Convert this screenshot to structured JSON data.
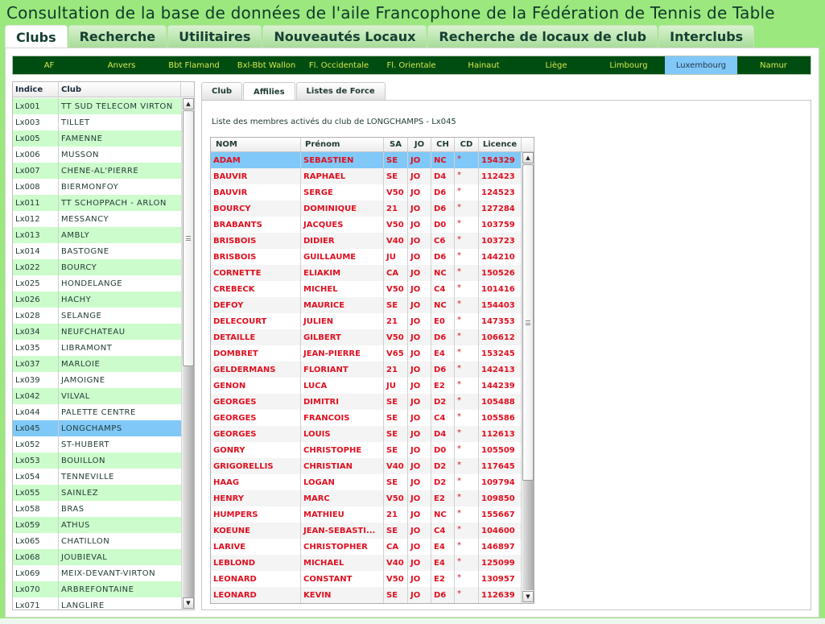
{
  "app": {
    "title": "Consultation de la base de données de l'aile Francophone de la Fédération de Tennis de Table"
  },
  "main_tabs": [
    {
      "label": "Clubs",
      "active": true
    },
    {
      "label": "Recherche",
      "active": false
    },
    {
      "label": "Utilitaires",
      "active": false
    },
    {
      "label": "Nouveautés Locaux",
      "active": false
    },
    {
      "label": "Recherche de locaux de club",
      "active": false
    },
    {
      "label": "Interclubs",
      "active": false
    }
  ],
  "regions": [
    {
      "label": "AF",
      "active": false
    },
    {
      "label": "Anvers",
      "active": false
    },
    {
      "label": "Bbt Flamand",
      "active": false
    },
    {
      "label": "Bxl-Bbt Wallon",
      "active": false
    },
    {
      "label": "Fl. Occidentale",
      "active": false
    },
    {
      "label": "Fl. Orientale",
      "active": false
    },
    {
      "label": "Hainaut",
      "active": false
    },
    {
      "label": "Liège",
      "active": false
    },
    {
      "label": "Limbourg",
      "active": false
    },
    {
      "label": "Luxembourg",
      "active": true
    },
    {
      "label": "Namur",
      "active": false
    }
  ],
  "club_list": {
    "headers": {
      "indice": "Indice",
      "club": "Club"
    },
    "selected_index": "Lx045",
    "rows": [
      {
        "indice": "Lx001",
        "club": "TT SUD TELECOM VIRTON"
      },
      {
        "indice": "Lx003",
        "club": "TILLET"
      },
      {
        "indice": "Lx005",
        "club": "FAMENNE"
      },
      {
        "indice": "Lx006",
        "club": "MUSSON"
      },
      {
        "indice": "Lx007",
        "club": "CHENE-AL'PIERRE"
      },
      {
        "indice": "Lx008",
        "club": "BIERMONFOY"
      },
      {
        "indice": "Lx011",
        "club": "TT SCHOPPACH - ARLON"
      },
      {
        "indice": "Lx012",
        "club": "MESSANCY"
      },
      {
        "indice": "Lx013",
        "club": "AMBLY"
      },
      {
        "indice": "Lx014",
        "club": "BASTOGNE"
      },
      {
        "indice": "Lx022",
        "club": "BOURCY"
      },
      {
        "indice": "Lx025",
        "club": "HONDELANGE"
      },
      {
        "indice": "Lx026",
        "club": "HACHY"
      },
      {
        "indice": "Lx028",
        "club": "SELANGE"
      },
      {
        "indice": "Lx034",
        "club": "NEUFCHATEAU"
      },
      {
        "indice": "Lx035",
        "club": "LIBRAMONT"
      },
      {
        "indice": "Lx037",
        "club": "MARLOIE"
      },
      {
        "indice": "Lx039",
        "club": "JAMOIGNE"
      },
      {
        "indice": "Lx042",
        "club": "VILVAL"
      },
      {
        "indice": "Lx044",
        "club": "PALETTE CENTRE"
      },
      {
        "indice": "Lx045",
        "club": "LONGCHAMPS"
      },
      {
        "indice": "Lx052",
        "club": "ST-HUBERT"
      },
      {
        "indice": "Lx053",
        "club": "BOUILLON"
      },
      {
        "indice": "Lx054",
        "club": "TENNEVILLE"
      },
      {
        "indice": "Lx055",
        "club": "SAINLEZ"
      },
      {
        "indice": "Lx058",
        "club": "BRAS"
      },
      {
        "indice": "Lx059",
        "club": "ATHUS"
      },
      {
        "indice": "Lx065",
        "club": "CHATILLON"
      },
      {
        "indice": "Lx068",
        "club": "JOUBIEVAL"
      },
      {
        "indice": "Lx069",
        "club": "MEIX-DEVANT-VIRTON"
      },
      {
        "indice": "Lx070",
        "club": "ARBREFONTAINE"
      },
      {
        "indice": "Lx071",
        "club": "LANGLIRE"
      }
    ]
  },
  "sub_tabs": [
    {
      "label": "Club",
      "active": false
    },
    {
      "label": "Affilies",
      "active": true
    },
    {
      "label": "Listes de Force",
      "active": false
    }
  ],
  "members": {
    "caption": "Liste des membres activés du club de LONGCHAMPS - Lx045",
    "headers": {
      "nom": "NOM",
      "prenom": "Prénom",
      "sa": "SA",
      "jo": "JO",
      "ch": "CH",
      "cd": "CD",
      "licence": "Licence"
    },
    "selected_licence": "154329",
    "rows": [
      {
        "nom": "ADAM",
        "prenom": "SEBASTIEN",
        "sa": "SE",
        "jo": "JO",
        "ch": "NC",
        "cd": "*",
        "licence": "154329"
      },
      {
        "nom": "BAUVIR",
        "prenom": "RAPHAEL",
        "sa": "SE",
        "jo": "JO",
        "ch": "D4",
        "cd": "*",
        "licence": "112423"
      },
      {
        "nom": "BAUVIR",
        "prenom": "SERGE",
        "sa": "V50",
        "jo": "JO",
        "ch": "D6",
        "cd": "*",
        "licence": "124523"
      },
      {
        "nom": "BOURCY",
        "prenom": "DOMINIQUE",
        "sa": "21",
        "jo": "JO",
        "ch": "D6",
        "cd": "*",
        "licence": "127284"
      },
      {
        "nom": "BRABANTS",
        "prenom": "JACQUES",
        "sa": "V50",
        "jo": "JO",
        "ch": "D0",
        "cd": "*",
        "licence": "103759"
      },
      {
        "nom": "BRISBOIS",
        "prenom": "DIDIER",
        "sa": "V40",
        "jo": "JO",
        "ch": "C6",
        "cd": "*",
        "licence": "103723"
      },
      {
        "nom": "BRISBOIS",
        "prenom": "GUILLAUME",
        "sa": "JU",
        "jo": "JO",
        "ch": "D6",
        "cd": "*",
        "licence": "144210"
      },
      {
        "nom": "CORNETTE",
        "prenom": "ELIAKIM",
        "sa": "CA",
        "jo": "JO",
        "ch": "NC",
        "cd": "*",
        "licence": "150526"
      },
      {
        "nom": "CREBECK",
        "prenom": "MICHEL",
        "sa": "V50",
        "jo": "JO",
        "ch": "C4",
        "cd": "*",
        "licence": "101416"
      },
      {
        "nom": "DEFOY",
        "prenom": "MAURICE",
        "sa": "SE",
        "jo": "JO",
        "ch": "NC",
        "cd": "*",
        "licence": "154403"
      },
      {
        "nom": "DELECOURT",
        "prenom": "JULIEN",
        "sa": "21",
        "jo": "JO",
        "ch": "E0",
        "cd": "*",
        "licence": "147353"
      },
      {
        "nom": "DETAILLE",
        "prenom": "GILBERT",
        "sa": "V50",
        "jo": "JO",
        "ch": "D6",
        "cd": "*",
        "licence": "106612"
      },
      {
        "nom": "DOMBRET",
        "prenom": "JEAN-PIERRE",
        "sa": "V65",
        "jo": "JO",
        "ch": "E4",
        "cd": "*",
        "licence": "153245"
      },
      {
        "nom": "GELDERMANS",
        "prenom": "FLORIANT",
        "sa": "21",
        "jo": "JO",
        "ch": "D6",
        "cd": "*",
        "licence": "142413"
      },
      {
        "nom": "GENON",
        "prenom": "LUCA",
        "sa": "JU",
        "jo": "JO",
        "ch": "E2",
        "cd": "*",
        "licence": "144239"
      },
      {
        "nom": "GEORGES",
        "prenom": "DIMITRI",
        "sa": "SE",
        "jo": "JO",
        "ch": "D2",
        "cd": "*",
        "licence": "105488"
      },
      {
        "nom": "GEORGES",
        "prenom": "FRANCOIS",
        "sa": "SE",
        "jo": "JO",
        "ch": "C4",
        "cd": "*",
        "licence": "105586"
      },
      {
        "nom": "GEORGES",
        "prenom": "LOUIS",
        "sa": "SE",
        "jo": "JO",
        "ch": "D4",
        "cd": "*",
        "licence": "112613"
      },
      {
        "nom": "GONRY",
        "prenom": "CHRISTOPHE",
        "sa": "SE",
        "jo": "JO",
        "ch": "D0",
        "cd": "*",
        "licence": "105509"
      },
      {
        "nom": "GRIGORELLIS",
        "prenom": "CHRISTIAN",
        "sa": "V40",
        "jo": "JO",
        "ch": "D2",
        "cd": "*",
        "licence": "117645"
      },
      {
        "nom": "HAAG",
        "prenom": "LOGAN",
        "sa": "SE",
        "jo": "JO",
        "ch": "D2",
        "cd": "*",
        "licence": "109794"
      },
      {
        "nom": "HENRY",
        "prenom": "MARC",
        "sa": "V50",
        "jo": "JO",
        "ch": "E2",
        "cd": "*",
        "licence": "109850"
      },
      {
        "nom": "HUMPERS",
        "prenom": "MATHIEU",
        "sa": "21",
        "jo": "JO",
        "ch": "NC",
        "cd": "*",
        "licence": "155667"
      },
      {
        "nom": "KOEUNE",
        "prenom": "JEAN-SEBASTI...",
        "sa": "SE",
        "jo": "JO",
        "ch": "C4",
        "cd": "*",
        "licence": "104600"
      },
      {
        "nom": "LARIVE",
        "prenom": "CHRISTOPHER",
        "sa": "CA",
        "jo": "JO",
        "ch": "E4",
        "cd": "*",
        "licence": "146897"
      },
      {
        "nom": "LEBLOND",
        "prenom": "MICHAEL",
        "sa": "V40",
        "jo": "JO",
        "ch": "E4",
        "cd": "*",
        "licence": "125099"
      },
      {
        "nom": "LEONARD",
        "prenom": "CONSTANT",
        "sa": "V50",
        "jo": "JO",
        "ch": "E2",
        "cd": "*",
        "licence": "130957"
      },
      {
        "nom": "LEONARD",
        "prenom": "KEVIN",
        "sa": "SE",
        "jo": "JO",
        "ch": "D6",
        "cd": "*",
        "licence": "112639"
      }
    ]
  },
  "icons": {
    "scroll_up": "▲",
    "scroll_down": "▼"
  }
}
